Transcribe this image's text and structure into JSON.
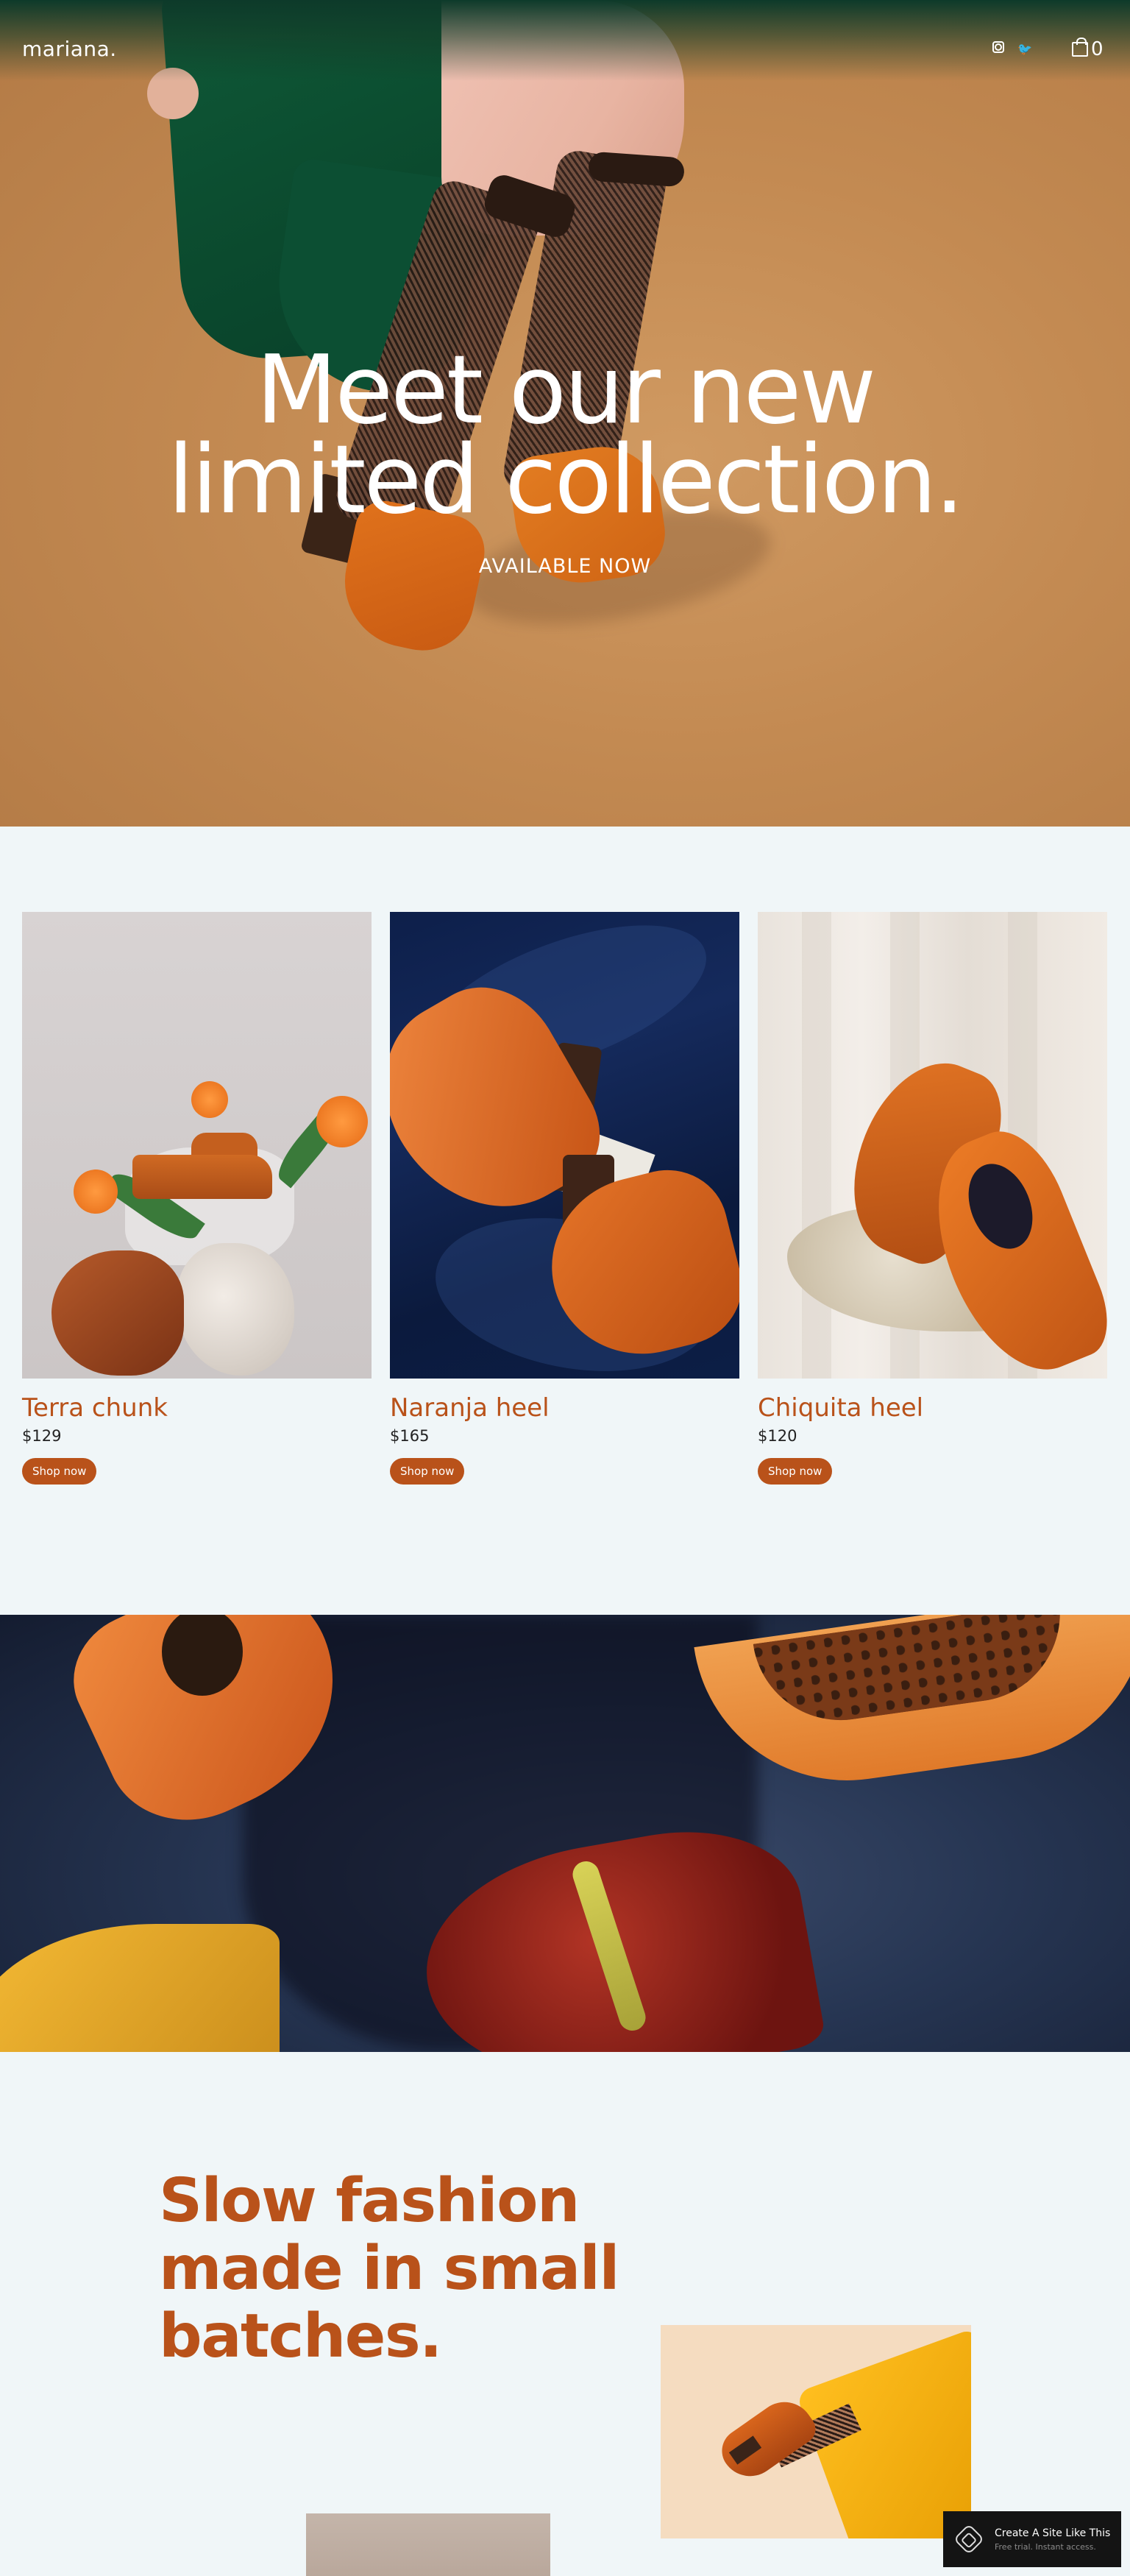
{
  "header": {
    "brand": "mariana.",
    "cart_count": "0",
    "twitter_glyph": "🐦"
  },
  "hero": {
    "title_line1": "Meet our new",
    "title_line2": "limited collection.",
    "subtitle": "AVAILABLE NOW"
  },
  "products": [
    {
      "name": "Terra chunk",
      "price": "$129",
      "button": "Shop now"
    },
    {
      "name": "Naranja heel",
      "price": "$165",
      "button": "Shop now"
    },
    {
      "name": "Chiquita heel",
      "price": "$120",
      "button": "Shop now"
    }
  ],
  "story": {
    "title_line1": "Slow fashion",
    "title_line2": "made in small",
    "title_line3": "batches."
  },
  "badge": {
    "title": "Create A Site Like This",
    "subtitle": "Free trial. Instant access."
  },
  "colors": {
    "accent": "#b9521a",
    "page_bg": "#f0f6f8",
    "badge_bg": "#141414"
  },
  "icons": [
    "instagram-icon",
    "twitter-icon",
    "shopping-bag-icon",
    "squarespace-logo-icon"
  ]
}
